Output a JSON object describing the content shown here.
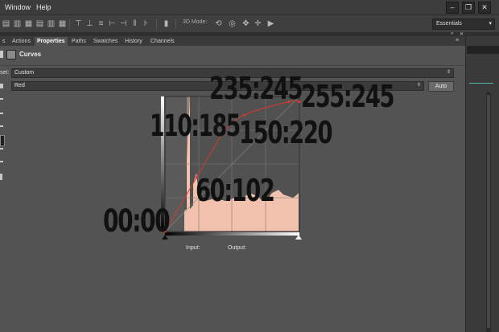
{
  "menu": {
    "items": [
      "Window",
      "Help"
    ]
  },
  "window_controls": {
    "minimize": "–",
    "restore": "❐",
    "close": "✕"
  },
  "options_bar": {
    "mode_label": "3D Mode:"
  },
  "workspace": {
    "value": "Essentials"
  },
  "tabs": [
    {
      "label": "s"
    },
    {
      "label": "Actions"
    },
    {
      "label": "Properties"
    },
    {
      "label": "Paths"
    },
    {
      "label": "Swatches"
    },
    {
      "label": "History"
    },
    {
      "label": "Channels"
    }
  ],
  "panel": {
    "title": "Curves",
    "preset_label": "set:",
    "preset_value": "Custom",
    "channel_value": "Red",
    "auto_label": "Auto",
    "input_label": "Input:",
    "output_label": "Output:"
  },
  "curve_points": [
    {
      "label": "00:00",
      "input": 0,
      "output": 0
    },
    {
      "label": "60:102",
      "input": 60,
      "output": 102
    },
    {
      "label": "110:185",
      "input": 110,
      "output": 185
    },
    {
      "label": "150:220",
      "input": 150,
      "output": 220
    },
    {
      "label": "235:245",
      "input": 235,
      "output": 245
    },
    {
      "label": "255:245",
      "input": 255,
      "output": 245
    }
  ],
  "colors": {
    "curve": "#d63a2b",
    "histogram": "#f3c2ae",
    "accent": "#4fb7a8"
  }
}
